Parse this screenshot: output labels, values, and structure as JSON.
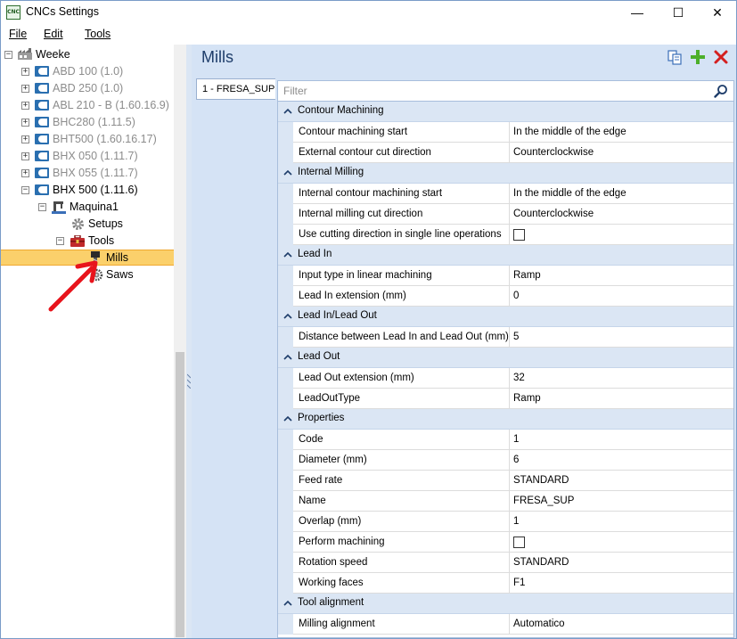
{
  "window": {
    "title": "CNCs Settings",
    "app_icon_text": "CNC",
    "minimize": "—",
    "maximize": "☐",
    "close": "✕"
  },
  "menu": {
    "file": "File",
    "edit": "Edit",
    "tools": "Tools"
  },
  "tree": {
    "root": "Weeke",
    "machines": [
      {
        "label": "ABD 100 (1.0)"
      },
      {
        "label": "ABD 250 (1.0)"
      },
      {
        "label": "ABL 210 - B (1.60.16.9)"
      },
      {
        "label": "BHC280 (1.11.5)"
      },
      {
        "label": "BHT500 (1.60.16.17)"
      },
      {
        "label": "BHX 050 (1.11.7)"
      },
      {
        "label": "BHX 055 (1.11.7)"
      },
      {
        "label": "BHX 500 (1.11.6)"
      }
    ],
    "maquina": "Maquina1",
    "setups": "Setups",
    "tools": "Tools",
    "mills": "Mills",
    "saws": "Saws",
    "expand_plus": "+",
    "expand_minus": "−"
  },
  "panel": {
    "title": "Mills",
    "tab_label": "1 - FRESA_SUP",
    "filter_placeholder": "Filter"
  },
  "categories": [
    {
      "label": "Contour Machining",
      "props": [
        {
          "name": "Contour machining start",
          "value": "In the middle of the edge"
        },
        {
          "name": "External contour cut direction",
          "value": "Counterclockwise"
        }
      ]
    },
    {
      "label": "Internal Milling",
      "props": [
        {
          "name": "Internal contour machining start",
          "value": "In the middle of the edge"
        },
        {
          "name": "Internal milling cut direction",
          "value": "Counterclockwise"
        },
        {
          "name": "Use cutting direction in single line operations",
          "value": "",
          "checkbox": true
        }
      ]
    },
    {
      "label": "Lead In",
      "props": [
        {
          "name": "Input type in linear machining",
          "value": "Ramp"
        },
        {
          "name": "Lead In extension (mm)",
          "value": "0"
        }
      ]
    },
    {
      "label": "Lead In/Lead Out",
      "props": [
        {
          "name": "Distance between Lead In and Lead Out (mm)",
          "value": "5"
        }
      ]
    },
    {
      "label": "Lead Out",
      "props": [
        {
          "name": "Lead Out extension (mm)",
          "value": "32"
        },
        {
          "name": "LeadOutType",
          "value": "Ramp"
        }
      ]
    },
    {
      "label": "Properties",
      "props": [
        {
          "name": "Code",
          "value": "1"
        },
        {
          "name": "Diameter (mm)",
          "value": "6"
        },
        {
          "name": "Feed rate",
          "value": "STANDARD"
        },
        {
          "name": "Name",
          "value": "FRESA_SUP"
        },
        {
          "name": "Overlap (mm)",
          "value": "1"
        },
        {
          "name": "Perform machining",
          "value": "",
          "checkbox": true
        },
        {
          "name": "Rotation speed",
          "value": "STANDARD"
        },
        {
          "name": "Working faces",
          "value": "F1"
        }
      ]
    },
    {
      "label": "Tool alignment",
      "props": [
        {
          "name": "Milling alignment",
          "value": "Automatico"
        }
      ]
    }
  ],
  "colors": {
    "selection": "#fbd06b",
    "panel_bg": "#d5e3f5",
    "title_blue": "#1e3d6a",
    "add_green": "#4caf2a",
    "delete_red": "#d42020",
    "arrow_red": "#e8141c"
  }
}
